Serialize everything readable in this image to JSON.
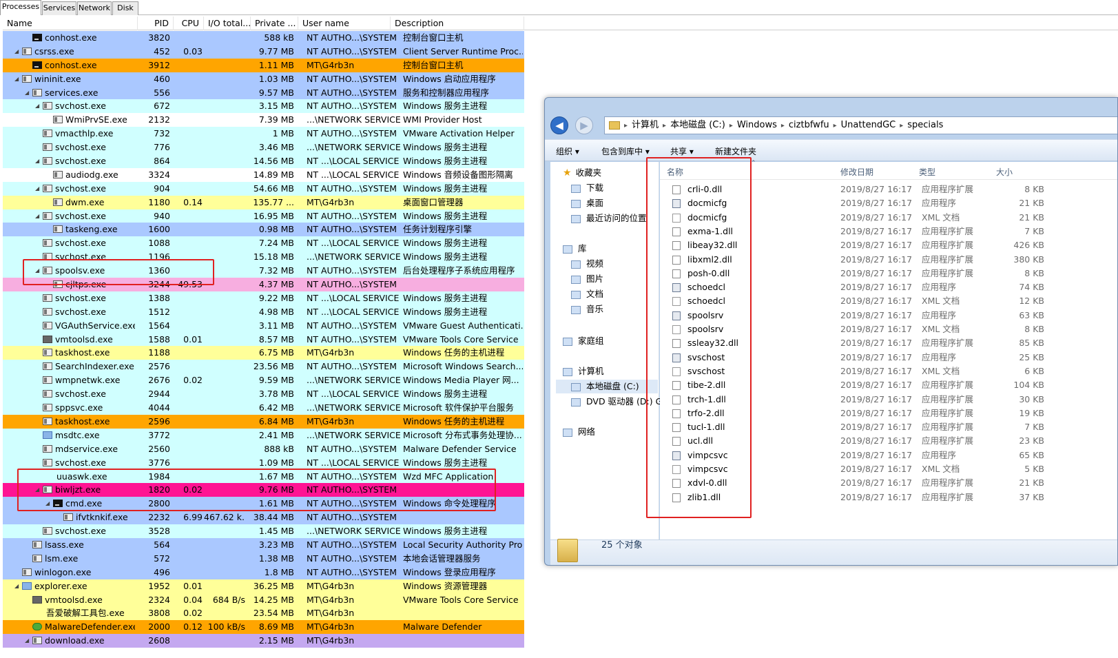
{
  "tabs": [
    "Processes",
    "Services",
    "Network",
    "Disk"
  ],
  "columns": {
    "name": "Name",
    "pid": "PID",
    "cpu": "CPU",
    "io": "I/O total...",
    "priv": "Private ...",
    "user": "User name",
    "desc": "Description"
  },
  "processes": [
    {
      "name": "conhost.exe",
      "pid": "3820",
      "cpu": "",
      "io": "",
      "priv": "588 kB",
      "user": "NT AUTHO...\\SYSTEM",
      "desc": "控制台窗口主机",
      "bg": "system",
      "indent": 2,
      "exp": "",
      "icon": "cmd"
    },
    {
      "name": "csrss.exe",
      "pid": "452",
      "cpu": "0.03",
      "io": "",
      "priv": "9.77 MB",
      "user": "NT AUTHO...\\SYSTEM",
      "desc": "Client Server Runtime Proc...",
      "bg": "system",
      "indent": 1,
      "exp": "◢",
      "icon": "win"
    },
    {
      "name": "conhost.exe",
      "pid": "3912",
      "cpu": "",
      "io": "",
      "priv": "1.11 MB",
      "user": "MT\\G4rb3n",
      "desc": "控制台窗口主机",
      "bg": "orange",
      "indent": 2,
      "exp": "",
      "icon": "cmd"
    },
    {
      "name": "wininit.exe",
      "pid": "460",
      "cpu": "",
      "io": "",
      "priv": "1.03 MB",
      "user": "NT AUTHO...\\SYSTEM",
      "desc": "Windows 启动应用程序",
      "bg": "system",
      "indent": 1,
      "exp": "◢",
      "icon": "win"
    },
    {
      "name": "services.exe",
      "pid": "556",
      "cpu": "",
      "io": "",
      "priv": "9.57 MB",
      "user": "NT AUTHO...\\SYSTEM",
      "desc": "服务和控制器应用程序",
      "bg": "system",
      "indent": 2,
      "exp": "◢",
      "icon": "win"
    },
    {
      "name": "svchost.exe",
      "pid": "672",
      "cpu": "",
      "io": "",
      "priv": "3.15 MB",
      "user": "NT AUTHO...\\SYSTEM",
      "desc": "Windows 服务主进程",
      "bg": "service",
      "indent": 3,
      "exp": "◢",
      "icon": "win"
    },
    {
      "name": "WmiPrvSE.exe",
      "pid": "2132",
      "cpu": "",
      "io": "",
      "priv": "7.39 MB",
      "user": "...\\NETWORK SERVICE",
      "desc": "WMI Provider Host",
      "bg": "white",
      "indent": 4,
      "exp": "",
      "icon": "win"
    },
    {
      "name": "vmacthlp.exe",
      "pid": "732",
      "cpu": "",
      "io": "",
      "priv": "1 MB",
      "user": "NT AUTHO...\\SYSTEM",
      "desc": "VMware Activation Helper",
      "bg": "service",
      "indent": 3,
      "exp": "",
      "icon": "win"
    },
    {
      "name": "svchost.exe",
      "pid": "776",
      "cpu": "",
      "io": "",
      "priv": "3.46 MB",
      "user": "...\\NETWORK SERVICE",
      "desc": "Windows 服务主进程",
      "bg": "service",
      "indent": 3,
      "exp": "",
      "icon": "win"
    },
    {
      "name": "svchost.exe",
      "pid": "864",
      "cpu": "",
      "io": "",
      "priv": "14.56 MB",
      "user": "NT ...\\LOCAL SERVICE",
      "desc": "Windows 服务主进程",
      "bg": "service",
      "indent": 3,
      "exp": "◢",
      "icon": "win"
    },
    {
      "name": "audiodg.exe",
      "pid": "3324",
      "cpu": "",
      "io": "",
      "priv": "14.89 MB",
      "user": "NT ...\\LOCAL SERVICE",
      "desc": "Windows 音频设备图形隔离",
      "bg": "white",
      "indent": 4,
      "exp": "",
      "icon": "win"
    },
    {
      "name": "svchost.exe",
      "pid": "904",
      "cpu": "",
      "io": "",
      "priv": "54.66 MB",
      "user": "NT AUTHO...\\SYSTEM",
      "desc": "Windows 服务主进程",
      "bg": "service",
      "indent": 3,
      "exp": "◢",
      "icon": "win"
    },
    {
      "name": "dwm.exe",
      "pid": "1180",
      "cpu": "0.14",
      "io": "",
      "priv": "135.77 ...",
      "user": "MT\\G4rb3n",
      "desc": "桌面窗口管理器",
      "bg": "own",
      "indent": 4,
      "exp": "",
      "icon": "win"
    },
    {
      "name": "svchost.exe",
      "pid": "940",
      "cpu": "",
      "io": "",
      "priv": "16.95 MB",
      "user": "NT AUTHO...\\SYSTEM",
      "desc": "Windows 服务主进程",
      "bg": "service",
      "indent": 3,
      "exp": "◢",
      "icon": "win"
    },
    {
      "name": "taskeng.exe",
      "pid": "1600",
      "cpu": "",
      "io": "",
      "priv": "0.98 MB",
      "user": "NT AUTHO...\\SYSTEM",
      "desc": "任务计划程序引擎",
      "bg": "system",
      "indent": 4,
      "exp": "",
      "icon": "win"
    },
    {
      "name": "svchost.exe",
      "pid": "1088",
      "cpu": "",
      "io": "",
      "priv": "7.24 MB",
      "user": "NT ...\\LOCAL SERVICE",
      "desc": "Windows 服务主进程",
      "bg": "service",
      "indent": 3,
      "exp": "",
      "icon": "win"
    },
    {
      "name": "svchost.exe",
      "pid": "1196",
      "cpu": "",
      "io": "",
      "priv": "15.18 MB",
      "user": "...\\NETWORK SERVICE",
      "desc": "Windows 服务主进程",
      "bg": "service",
      "indent": 3,
      "exp": "",
      "icon": "win"
    },
    {
      "name": "spoolsv.exe",
      "pid": "1360",
      "cpu": "",
      "io": "",
      "priv": "7.32 MB",
      "user": "NT AUTHO...\\SYSTEM",
      "desc": "后台处理程序子系统应用程序",
      "bg": "service",
      "indent": 3,
      "exp": "◢",
      "icon": "win"
    },
    {
      "name": "cjltps.exe",
      "pid": "3244",
      "cpu": "49.53",
      "io": "",
      "priv": "4.37 MB",
      "user": "NT AUTHO...\\SYSTEM",
      "desc": "",
      "bg": "pink",
      "indent": 4,
      "exp": "",
      "icon": "win"
    },
    {
      "name": "svchost.exe",
      "pid": "1388",
      "cpu": "",
      "io": "",
      "priv": "9.22 MB",
      "user": "NT ...\\LOCAL SERVICE",
      "desc": "Windows 服务主进程",
      "bg": "service",
      "indent": 3,
      "exp": "",
      "icon": "win"
    },
    {
      "name": "svchost.exe",
      "pid": "1512",
      "cpu": "",
      "io": "",
      "priv": "4.98 MB",
      "user": "NT ...\\LOCAL SERVICE",
      "desc": "Windows 服务主进程",
      "bg": "service",
      "indent": 3,
      "exp": "",
      "icon": "win"
    },
    {
      "name": "VGAuthService.exe",
      "pid": "1564",
      "cpu": "",
      "io": "",
      "priv": "3.11 MB",
      "user": "NT AUTHO...\\SYSTEM",
      "desc": "VMware Guest Authenticati...",
      "bg": "service",
      "indent": 3,
      "exp": "",
      "icon": "win"
    },
    {
      "name": "vmtoolsd.exe",
      "pid": "1588",
      "cpu": "0.01",
      "io": "",
      "priv": "8.57 MB",
      "user": "NT AUTHO...\\SYSTEM",
      "desc": "VMware Tools Core Service",
      "bg": "service",
      "indent": 3,
      "exp": "",
      "icon": "vm"
    },
    {
      "name": "taskhost.exe",
      "pid": "1188",
      "cpu": "",
      "io": "",
      "priv": "6.75 MB",
      "user": "MT\\G4rb3n",
      "desc": "Windows 任务的主机进程",
      "bg": "own",
      "indent": 3,
      "exp": "",
      "icon": "win"
    },
    {
      "name": "SearchIndexer.exe",
      "pid": "2576",
      "cpu": "",
      "io": "",
      "priv": "23.56 MB",
      "user": "NT AUTHO...\\SYSTEM",
      "desc": "Microsoft Windows Search...",
      "bg": "service",
      "indent": 3,
      "exp": "",
      "icon": "win"
    },
    {
      "name": "wmpnetwk.exe",
      "pid": "2676",
      "cpu": "0.02",
      "io": "",
      "priv": "9.59 MB",
      "user": "...\\NETWORK SERVICE",
      "desc": "Windows Media Player 网...",
      "bg": "service",
      "indent": 3,
      "exp": "",
      "icon": "win"
    },
    {
      "name": "svchost.exe",
      "pid": "2944",
      "cpu": "",
      "io": "",
      "priv": "3.78 MB",
      "user": "NT ...\\LOCAL SERVICE",
      "desc": "Windows 服务主进程",
      "bg": "service",
      "indent": 3,
      "exp": "",
      "icon": "win"
    },
    {
      "name": "sppsvc.exe",
      "pid": "4044",
      "cpu": "",
      "io": "",
      "priv": "6.42 MB",
      "user": "...\\NETWORK SERVICE",
      "desc": "Microsoft 软件保护平台服务",
      "bg": "service",
      "indent": 3,
      "exp": "",
      "icon": "win"
    },
    {
      "name": "taskhost.exe",
      "pid": "2596",
      "cpu": "",
      "io": "",
      "priv": "6.84 MB",
      "user": "MT\\G4rb3n",
      "desc": "Windows 任务的主机进程",
      "bg": "orange",
      "indent": 3,
      "exp": "",
      "icon": "win"
    },
    {
      "name": "msdtc.exe",
      "pid": "3772",
      "cpu": "",
      "io": "",
      "priv": "2.41 MB",
      "user": "...\\NETWORK SERVICE",
      "desc": "Microsoft 分布式事务处理协...",
      "bg": "service",
      "indent": 3,
      "exp": "",
      "icon": "blue"
    },
    {
      "name": "mdservice.exe",
      "pid": "2560",
      "cpu": "",
      "io": "",
      "priv": "888 kB",
      "user": "NT AUTHO...\\SYSTEM",
      "desc": "Malware Defender Service",
      "bg": "service",
      "indent": 3,
      "exp": "",
      "icon": "win"
    },
    {
      "name": "svchost.exe",
      "pid": "3776",
      "cpu": "",
      "io": "",
      "priv": "1.09 MB",
      "user": "NT ...\\LOCAL SERVICE",
      "desc": "Windows 服务主进程",
      "bg": "service",
      "indent": 3,
      "exp": "",
      "icon": "win"
    },
    {
      "name": "uuaswk.exe",
      "pid": "1984",
      "cpu": "",
      "io": "",
      "priv": "1.67 MB",
      "user": "NT AUTHO...\\SYSTEM",
      "desc": "Wzd MFC Application",
      "bg": "service",
      "indent": 3,
      "exp": "",
      "icon": "none"
    },
    {
      "name": "biwljzt.exe",
      "pid": "1820",
      "cpu": "0.02",
      "io": "",
      "priv": "9.76 MB",
      "user": "NT AUTHO...\\SYSTEM",
      "desc": "",
      "bg": "magenta",
      "indent": 3,
      "exp": "◢",
      "icon": "win"
    },
    {
      "name": "cmd.exe",
      "pid": "2800",
      "cpu": "",
      "io": "",
      "priv": "1.61 MB",
      "user": "NT AUTHO...\\SYSTEM",
      "desc": "Windows 命令处理程序",
      "bg": "system",
      "indent": 4,
      "exp": "◢",
      "icon": "cmd"
    },
    {
      "name": "ifvtknkif.exe",
      "pid": "2232",
      "cpu": "6.99",
      "io": "467.62 k...",
      "priv": "38.44 MB",
      "user": "NT AUTHO...\\SYSTEM",
      "desc": "",
      "bg": "system",
      "indent": 5,
      "exp": "",
      "icon": "win"
    },
    {
      "name": "svchost.exe",
      "pid": "3528",
      "cpu": "",
      "io": "",
      "priv": "1.45 MB",
      "user": "...\\NETWORK SERVICE",
      "desc": "Windows 服务主进程",
      "bg": "service",
      "indent": 3,
      "exp": "",
      "icon": "win"
    },
    {
      "name": "lsass.exe",
      "pid": "564",
      "cpu": "",
      "io": "",
      "priv": "3.23 MB",
      "user": "NT AUTHO...\\SYSTEM",
      "desc": "Local Security Authority Pro...",
      "bg": "system",
      "indent": 2,
      "exp": "",
      "icon": "win"
    },
    {
      "name": "lsm.exe",
      "pid": "572",
      "cpu": "",
      "io": "",
      "priv": "1.38 MB",
      "user": "NT AUTHO...\\SYSTEM",
      "desc": "本地会话管理器服务",
      "bg": "system",
      "indent": 2,
      "exp": "",
      "icon": "win"
    },
    {
      "name": "winlogon.exe",
      "pid": "496",
      "cpu": "",
      "io": "",
      "priv": "1.8 MB",
      "user": "NT AUTHO...\\SYSTEM",
      "desc": "Windows 登录应用程序",
      "bg": "system",
      "indent": 1,
      "exp": "",
      "icon": "win"
    },
    {
      "name": "explorer.exe",
      "pid": "1952",
      "cpu": "0.01",
      "io": "",
      "priv": "36.25 MB",
      "user": "MT\\G4rb3n",
      "desc": "Windows 资源管理器",
      "bg": "own",
      "indent": 1,
      "exp": "◢",
      "icon": "blue"
    },
    {
      "name": "vmtoolsd.exe",
      "pid": "2324",
      "cpu": "0.04",
      "io": "684 B/s",
      "priv": "14.25 MB",
      "user": "MT\\G4rb3n",
      "desc": "VMware Tools Core Service",
      "bg": "own",
      "indent": 2,
      "exp": "",
      "icon": "vm"
    },
    {
      "name": "吾爱破解工具包.exe",
      "pid": "3808",
      "cpu": "0.02",
      "io": "",
      "priv": "23.54 MB",
      "user": "MT\\G4rb3n",
      "desc": "",
      "bg": "own",
      "indent": 2,
      "exp": "",
      "icon": "none"
    },
    {
      "name": "MalwareDefender.exe",
      "pid": "2000",
      "cpu": "0.12",
      "io": "100 kB/s",
      "priv": "8.69 MB",
      "user": "MT\\G4rb3n",
      "desc": "Malware Defender",
      "bg": "orange",
      "indent": 2,
      "exp": "",
      "icon": "green"
    },
    {
      "name": "download.exe",
      "pid": "2608",
      "cpu": "",
      "io": "",
      "priv": "2.15 MB",
      "user": "MT\\G4rb3n",
      "desc": "",
      "bg": "purple",
      "indent": 2,
      "exp": "◢",
      "icon": "win"
    }
  ],
  "explorer": {
    "breadcrumb": [
      "计算机",
      "本地磁盘 (C:)",
      "Windows",
      "ciztbfwfu",
      "UnattendGC",
      "specials"
    ],
    "toolbar": [
      "组织 ▾",
      "包含到库中 ▾",
      "共享 ▾",
      "新建文件夹"
    ],
    "nav": [
      {
        "label": "收藏夹",
        "kind": "header",
        "icon": "star-icon"
      },
      {
        "label": "下载",
        "kind": "sub",
        "icon": "download-folder-icon"
      },
      {
        "label": "桌面",
        "kind": "sub",
        "icon": "desktop-icon"
      },
      {
        "label": "最近访问的位置",
        "kind": "sub",
        "icon": "recent-places-icon"
      },
      {
        "label": "库",
        "kind": "header",
        "icon": "library-icon"
      },
      {
        "label": "视频",
        "kind": "sub",
        "icon": "video-icon"
      },
      {
        "label": "图片",
        "kind": "sub",
        "icon": "pictures-icon"
      },
      {
        "label": "文档",
        "kind": "sub",
        "icon": "documents-icon"
      },
      {
        "label": "音乐",
        "kind": "sub",
        "icon": "music-icon"
      },
      {
        "label": "家庭组",
        "kind": "header",
        "icon": "homegroup-icon"
      },
      {
        "label": "计算机",
        "kind": "header",
        "icon": "computer-icon"
      },
      {
        "label": "本地磁盘 (C:)",
        "kind": "sel",
        "icon": "drive-icon"
      },
      {
        "label": "DVD 驱动器 (D:) GF",
        "kind": "sub",
        "icon": "dvd-icon"
      },
      {
        "label": "网络",
        "kind": "header",
        "icon": "network-icon"
      }
    ],
    "headers": {
      "name": "名称",
      "date": "修改日期",
      "type": "类型",
      "size": "大小"
    },
    "files": [
      {
        "name": "crli-0.dll",
        "date": "2019/8/27 16:17",
        "type": "应用程序扩展",
        "size": "8 KB",
        "kind": "dll"
      },
      {
        "name": "docmicfg",
        "date": "2019/8/27 16:17",
        "type": "应用程序",
        "size": "21 KB",
        "kind": "app"
      },
      {
        "name": "docmicfg",
        "date": "2019/8/27 16:17",
        "type": "XML 文档",
        "size": "21 KB",
        "kind": "xml"
      },
      {
        "name": "exma-1.dll",
        "date": "2019/8/27 16:17",
        "type": "应用程序扩展",
        "size": "7 KB",
        "kind": "dll"
      },
      {
        "name": "libeay32.dll",
        "date": "2019/8/27 16:17",
        "type": "应用程序扩展",
        "size": "426 KB",
        "kind": "dll"
      },
      {
        "name": "libxml2.dll",
        "date": "2019/8/27 16:17",
        "type": "应用程序扩展",
        "size": "380 KB",
        "kind": "dll"
      },
      {
        "name": "posh-0.dll",
        "date": "2019/8/27 16:17",
        "type": "应用程序扩展",
        "size": "8 KB",
        "kind": "dll"
      },
      {
        "name": "schoedcl",
        "date": "2019/8/27 16:17",
        "type": "应用程序",
        "size": "74 KB",
        "kind": "app"
      },
      {
        "name": "schoedcl",
        "date": "2019/8/27 16:17",
        "type": "XML 文档",
        "size": "12 KB",
        "kind": "xml"
      },
      {
        "name": "spoolsrv",
        "date": "2019/8/27 16:17",
        "type": "应用程序",
        "size": "63 KB",
        "kind": "app"
      },
      {
        "name": "spoolsrv",
        "date": "2019/8/27 16:17",
        "type": "XML 文档",
        "size": "8 KB",
        "kind": "xml"
      },
      {
        "name": "ssleay32.dll",
        "date": "2019/8/27 16:17",
        "type": "应用程序扩展",
        "size": "85 KB",
        "kind": "dll"
      },
      {
        "name": "svschost",
        "date": "2019/8/27 16:17",
        "type": "应用程序",
        "size": "25 KB",
        "kind": "app"
      },
      {
        "name": "svschost",
        "date": "2019/8/27 16:17",
        "type": "XML 文档",
        "size": "6 KB",
        "kind": "xml"
      },
      {
        "name": "tibe-2.dll",
        "date": "2019/8/27 16:17",
        "type": "应用程序扩展",
        "size": "104 KB",
        "kind": "dll"
      },
      {
        "name": "trch-1.dll",
        "date": "2019/8/27 16:17",
        "type": "应用程序扩展",
        "size": "30 KB",
        "kind": "dll"
      },
      {
        "name": "trfo-2.dll",
        "date": "2019/8/27 16:17",
        "type": "应用程序扩展",
        "size": "19 KB",
        "kind": "dll"
      },
      {
        "name": "tucl-1.dll",
        "date": "2019/8/27 16:17",
        "type": "应用程序扩展",
        "size": "7 KB",
        "kind": "dll"
      },
      {
        "name": "ucl.dll",
        "date": "2019/8/27 16:17",
        "type": "应用程序扩展",
        "size": "23 KB",
        "kind": "dll"
      },
      {
        "name": "vimpcsvc",
        "date": "2019/8/27 16:17",
        "type": "应用程序",
        "size": "65 KB",
        "kind": "app"
      },
      {
        "name": "vimpcsvc",
        "date": "2019/8/27 16:17",
        "type": "XML 文档",
        "size": "5 KB",
        "kind": "xml"
      },
      {
        "name": "xdvl-0.dll",
        "date": "2019/8/27 16:17",
        "type": "应用程序扩展",
        "size": "21 KB",
        "kind": "dll"
      },
      {
        "name": "zlib1.dll",
        "date": "2019/8/27 16:17",
        "type": "应用程序扩展",
        "size": "37 KB",
        "kind": "dll"
      }
    ],
    "status": "25 个对象"
  },
  "colors": {
    "highlight_box": "#e02020",
    "service": "#d0ffff",
    "system": "#aac8ff",
    "own": "#ffff99",
    "pink": "#f7aee0",
    "orange": "#ffa500",
    "magenta": "#ff1493",
    "purple": "#c4a8f0"
  }
}
